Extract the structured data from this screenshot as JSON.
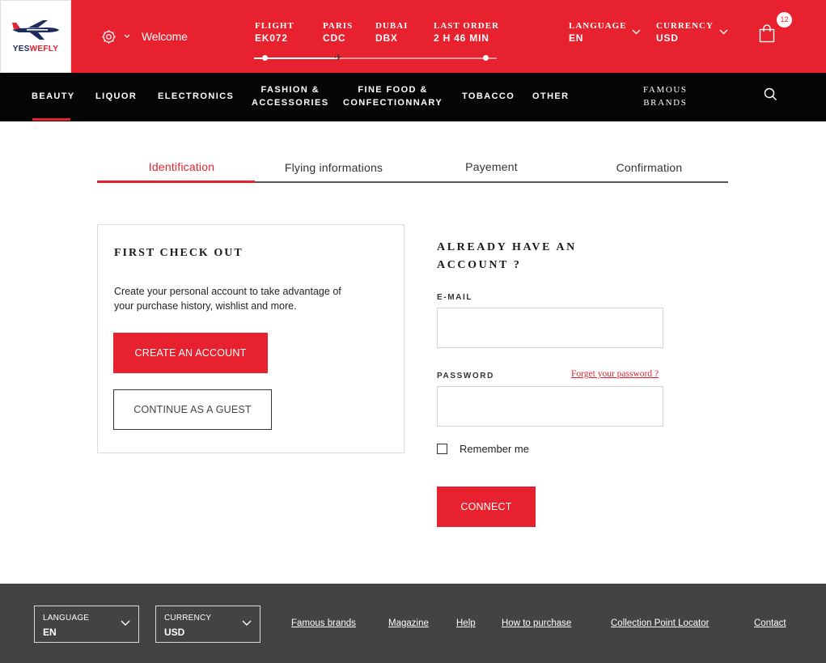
{
  "brand": {
    "name_part1": "YES",
    "name_part2": "WEFLY",
    "primary_color": "#e8212f",
    "navy_color": "#1c2a5c"
  },
  "header": {
    "welcome": "Welcome",
    "flight": {
      "label": "FLIGHT",
      "value": "EK072"
    },
    "origin": {
      "label": "PARIS",
      "value": "CDC"
    },
    "destination": {
      "label": "DUBAI",
      "value": "DBX"
    },
    "last_order": {
      "label": "LAST ORDER",
      "value": "2 H 46 MIN"
    },
    "flight_progress": 0.35,
    "language": {
      "label": "LANGUAGE",
      "value": "EN"
    },
    "currency": {
      "label": "CURRENCY",
      "value": "USD"
    },
    "cart_count": "12",
    "icons": [
      "settings-gear-icon",
      "chevron-down-icon",
      "shopping-bag-icon",
      "plane-icon"
    ]
  },
  "categories": [
    "BEAUTY",
    "LIQUOR",
    "ELECTRONICS",
    "FASHION &",
    "ACCESSORIES",
    "FINE FOOD &",
    "CONFECTIONNARY",
    "TOBACCO",
    "OTHER",
    "FAMOUS",
    "BRANDS"
  ],
  "active_category": "BEAUTY",
  "steps": [
    {
      "label": "Identification",
      "active": true
    },
    {
      "label": "Flying informations",
      "active": false
    },
    {
      "label": "Payement",
      "active": false
    },
    {
      "label": "Confirmation",
      "active": false
    }
  ],
  "first_checkout": {
    "title": "FIRST CHECK OUT",
    "description": "Create your personal account to take advantage of your purchase history, wishlist and more.",
    "create_account": "CREATE AN ACCOUNT",
    "continue_guest": "CONTINUE AS A GUEST"
  },
  "login": {
    "title": "ALREADY HAVE AN ACCOUNT ?",
    "email_label": "E-MAIL",
    "email_value": "",
    "password_label": "PASSWORD",
    "password_value": "",
    "forgot": "Forget your password ?",
    "remember": "Remember me",
    "remember_checked": false,
    "connect": "CONNECT"
  },
  "footer": {
    "language": {
      "label": "LANGUAGE",
      "value": "EN"
    },
    "currency": {
      "label": "CURRENCY",
      "value": "USD"
    },
    "links": [
      "Famous brands",
      "Magazine",
      "Help",
      "How to purchase",
      "Collection Point Locator",
      "Contact"
    ]
  }
}
